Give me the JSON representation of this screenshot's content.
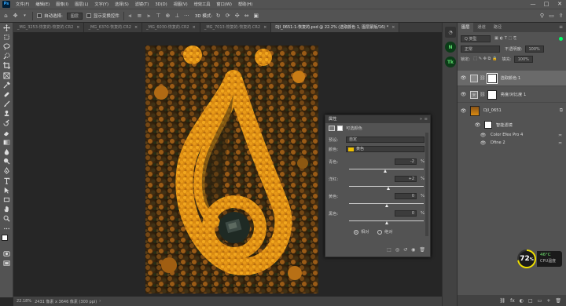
{
  "menubar": {
    "app_icon": "Ps",
    "items": [
      "文件(F)",
      "编辑(E)",
      "图像(I)",
      "图层(L)",
      "文字(Y)",
      "选择(S)",
      "滤镜(T)",
      "3D(D)",
      "视图(V)",
      "增效工具",
      "窗口(W)",
      "帮助(H)"
    ],
    "minimize": "—",
    "maximize": "□",
    "close": "✕"
  },
  "optionsbar": {
    "auto_select_label": "自动选择:",
    "auto_select_value": "图层",
    "show_transform_label": "显示变换控件",
    "mode_label": "3D 模式:"
  },
  "tabs": [
    {
      "label": "_MG_3253-恢复的-恢复的.CR2",
      "active": false
    },
    {
      "label": "_MG_6370-恢复的.CR2",
      "active": false
    },
    {
      "label": "_MG_6030-恢复的.CR2",
      "active": false
    },
    {
      "label": "_MG_7013-恢复的-恢复的.CR2",
      "active": false
    },
    {
      "label": "DJI_0651-1-恢复的.psd @ 22.2% (选取颜色 1, 图层蒙版/16) *",
      "active": true
    }
  ],
  "tab_close": "×",
  "statusbar": {
    "zoom": "22.18%",
    "doc_info": "2431 像素 x 3646 像素 (300 ppi)"
  },
  "layers_panel": {
    "tabs": [
      "图层",
      "通道",
      "路径"
    ],
    "kind_label": "Q 类型",
    "blend_mode": "正常",
    "opacity_label": "不透明度:",
    "opacity_value": "100%",
    "lock_label": "锁定:",
    "fill_label": "填充:",
    "fill_value": "100%",
    "layers": [
      {
        "name": "选取颜色 1",
        "selected": true
      },
      {
        "name": "亮度/对比度 1",
        "selected": false
      },
      {
        "name": "DJI_0651",
        "selected": false
      },
      {
        "name": "智能滤镜",
        "selected": false
      },
      {
        "name": "Color Efex Pro 4",
        "selected": false
      },
      {
        "name": "Dfine 2",
        "selected": false
      }
    ],
    "bottom_icons": [
      "fx",
      "◐",
      "□",
      "▭",
      "+",
      "🗑"
    ]
  },
  "properties_panel": {
    "title": "属性",
    "subtitle": "可选颜色",
    "preset_label": "预设:",
    "preset_value": "自定",
    "colors_label": "颜色:",
    "colors_value": "黄色",
    "colors_swatch": "#f0c000",
    "sliders": [
      {
        "label": "青色:",
        "value": "-2",
        "unit": "%",
        "level": -2
      },
      {
        "label": "洋红:",
        "value": "+2",
        "unit": "%",
        "level": 2
      },
      {
        "label": "黄色:",
        "value": "0",
        "unit": "%",
        "level": 0
      },
      {
        "label": "黑色:",
        "value": "0",
        "unit": "%",
        "level": 0
      }
    ],
    "method_relative": "相对",
    "method_absolute": "绝对"
  },
  "cpu_widget": {
    "percent": "72",
    "percent_symbol": "%",
    "temp": "46°C",
    "label": "CPU温度"
  },
  "colors": {
    "accent_cyan": "#00b4ff",
    "cpu_yellow": "#f0e000",
    "selected_layer": "#6a6a6a"
  }
}
